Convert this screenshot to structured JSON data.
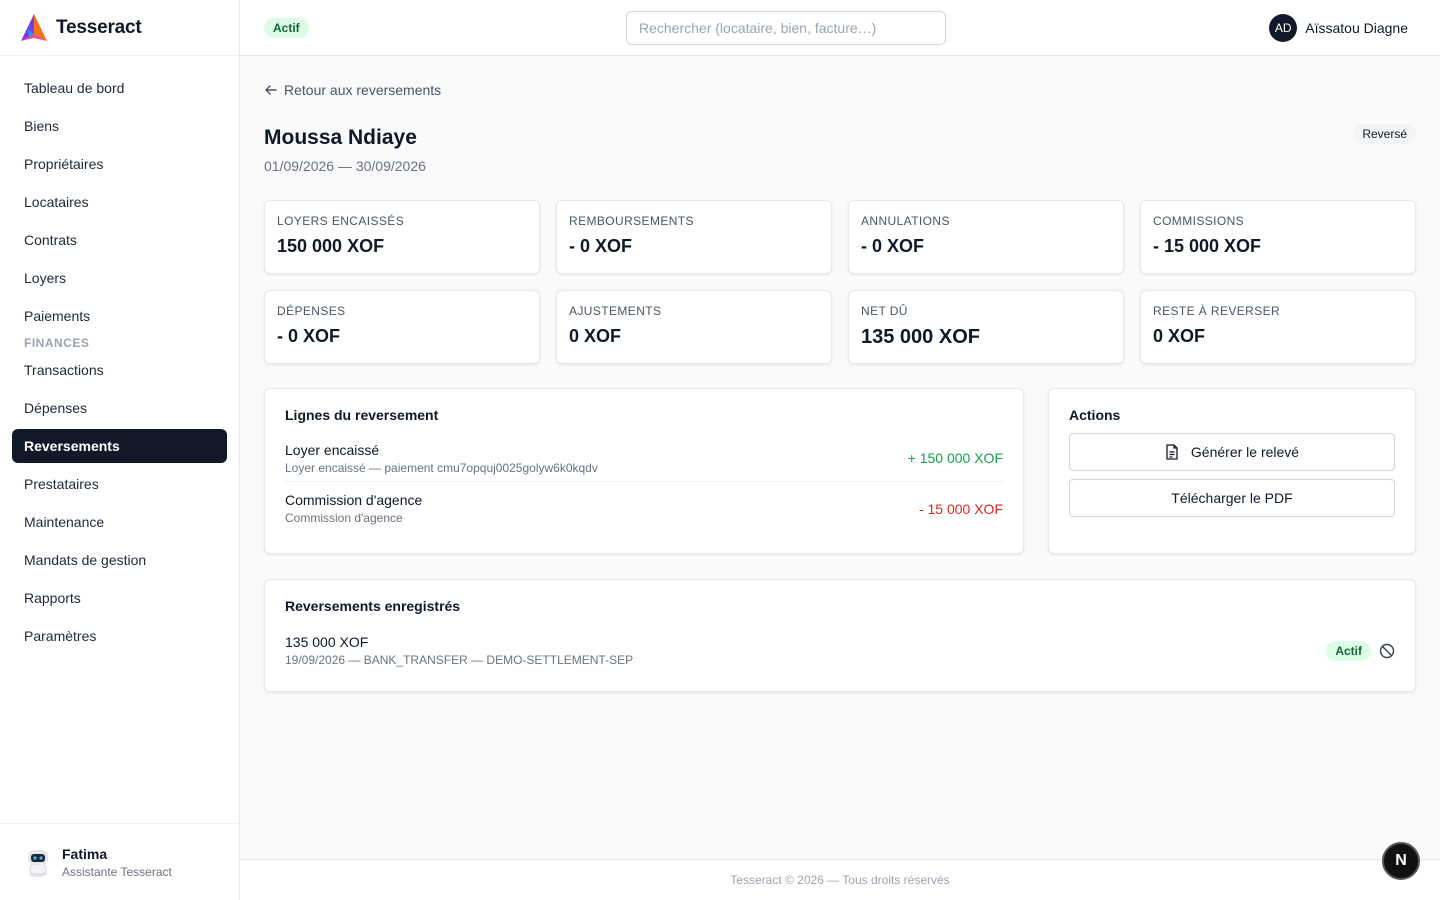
{
  "brand": {
    "name": "Tesseract"
  },
  "sidebar": {
    "items": [
      {
        "label": "Tableau de bord"
      },
      {
        "label": "Biens"
      },
      {
        "label": "Propriétaires"
      },
      {
        "label": "Locataires"
      },
      {
        "label": "Contrats"
      },
      {
        "label": "Loyers"
      },
      {
        "label": "Paiements"
      }
    ],
    "section": "FINANCES",
    "finance_items": [
      {
        "label": "Transactions"
      },
      {
        "label": "Dépenses"
      },
      {
        "label": "Reversements"
      },
      {
        "label": "Prestataires"
      },
      {
        "label": "Maintenance"
      },
      {
        "label": "Mandats de gestion"
      },
      {
        "label": "Rapports"
      },
      {
        "label": "Paramètres"
      }
    ],
    "assistant": {
      "name": "Fatima",
      "subtitle": "Assistante Tesseract"
    }
  },
  "header": {
    "status": "Actif",
    "search_placeholder": "Rechercher (locataire, bien, facture…)",
    "user": {
      "initials": "AD",
      "name": "Aïssatou Diagne"
    }
  },
  "page": {
    "back_label": "Retour aux reversements",
    "title": "Moussa Ndiaye",
    "period": "01/09/2026 — 30/09/2026",
    "status": "Reversé"
  },
  "stats": [
    {
      "label": "LOYERS ENCAISSÉS",
      "value": "150 000 XOF"
    },
    {
      "label": "REMBOURSEMENTS",
      "value": "- 0 XOF"
    },
    {
      "label": "ANNULATIONS",
      "value": "- 0 XOF"
    },
    {
      "label": "COMMISSIONS",
      "value": "- 15 000 XOF"
    },
    {
      "label": "DÉPENSES",
      "value": "- 0 XOF"
    },
    {
      "label": "AJUSTEMENTS",
      "value": "0 XOF"
    },
    {
      "label": "NET DÛ",
      "value": "135 000 XOF"
    },
    {
      "label": "RESTE À REVERSER",
      "value": "0 XOF"
    }
  ],
  "lines": {
    "title": "Lignes du reversement",
    "rows": [
      {
        "name": "Loyer encaissé",
        "sub": "Loyer encaissé — paiement cmu7opquj0025golyw6k0kqdv",
        "amount": "+ 150 000 XOF"
      },
      {
        "name": "Commission d'agence",
        "sub": "Commission d'agence",
        "amount": "- 15 000 XOF"
      }
    ]
  },
  "actions": {
    "title": "Actions",
    "generate_label": "Générer le relevé",
    "download_label": "Télécharger le PDF"
  },
  "recorded": {
    "title": "Reversements enregistrés",
    "amount": "135 000 XOF",
    "details": "19/09/2026 — BANK_TRANSFER — DEMO-SETTLEMENT-SEP",
    "status": "Actif"
  },
  "footer": {
    "text": "Tesseract © 2026 — Tous droits réservés"
  },
  "fab": {
    "label": "N"
  },
  "colors": {
    "accent": "#111827",
    "positive": "#16a34a",
    "negative": "#dc2626",
    "badge_green": "#dcfce7"
  }
}
